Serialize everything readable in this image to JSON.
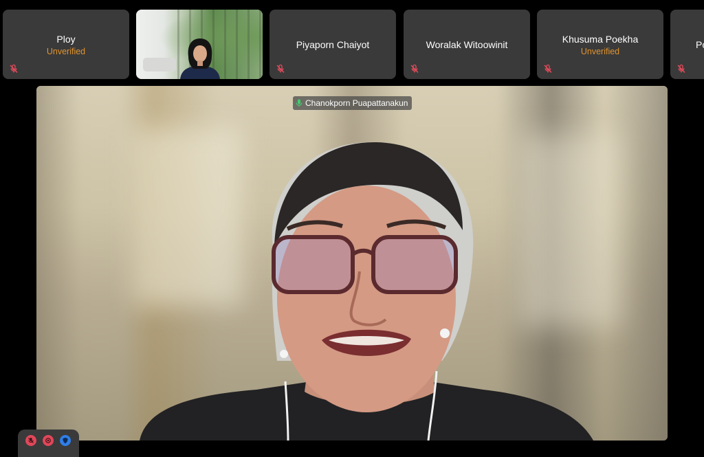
{
  "participants_strip": [
    {
      "name": "Ploy",
      "status": "Unverified",
      "muted": true
    },
    {
      "name": "",
      "status": "",
      "muted": false,
      "video": true
    },
    {
      "name": "Piyaporn Chaiyot",
      "status": "",
      "muted": true
    },
    {
      "name": "Woralak Witoowinit",
      "status": "",
      "muted": true
    },
    {
      "name": "Khusuma Poekha",
      "status": "Unverified",
      "muted": true
    },
    {
      "name": "Po",
      "status": "",
      "muted": true
    }
  ],
  "active_speaker": {
    "name": "Chanokporn Puapattanakun"
  },
  "colors": {
    "tile_bg": "#3a3a3a",
    "unverified": "#e0932f",
    "mute_icon": "#e74c5c",
    "control_red": "#e0475a",
    "control_blue": "#2f7ee6"
  },
  "icons": {
    "muted": "mic-muted-icon",
    "speaking": "mic-active-icon",
    "controls": [
      "mic-toggle-icon",
      "record-icon",
      "shield-icon"
    ]
  }
}
